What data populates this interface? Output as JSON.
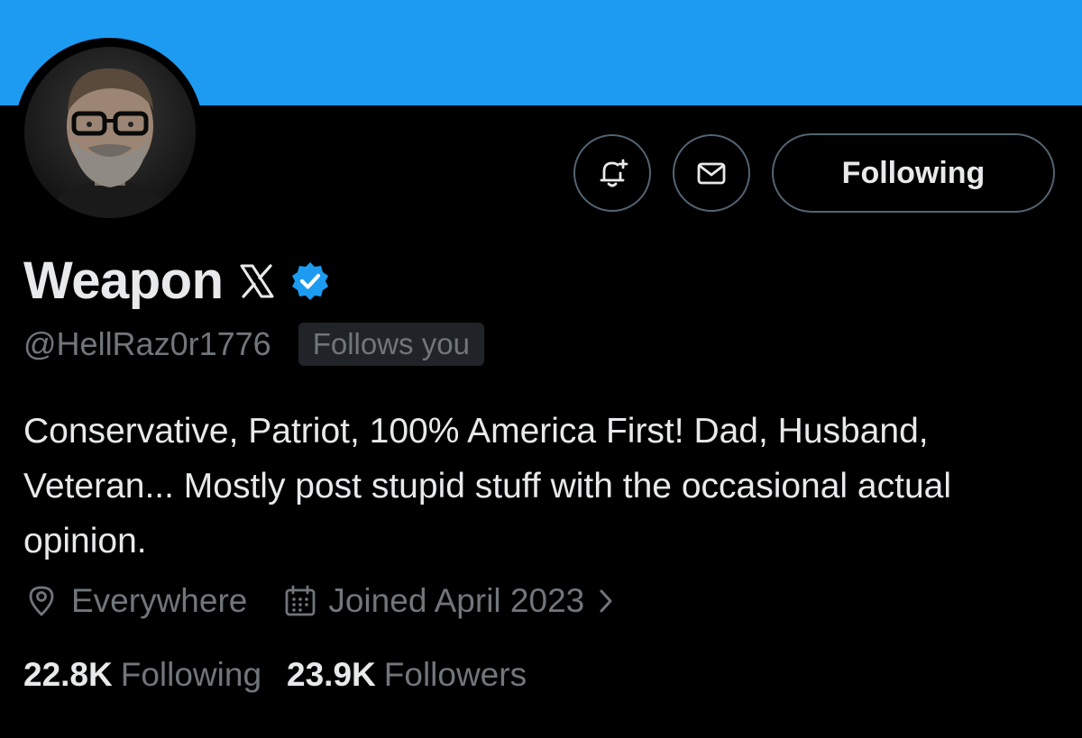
{
  "profile": {
    "display_name": "Weapon",
    "handle": "@HellRaz0r1776",
    "follows_you_badge": "Follows you",
    "bio": "Conservative, Patriot, 100% America First! Dad, Husband, Veteran... Mostly post stupid stuff with the occasional actual opinion.",
    "location": "Everywhere",
    "joined": "Joined April 2023",
    "following_count": "22.8K",
    "following_label": "Following",
    "followers_count": "23.9K",
    "followers_label": "Followers"
  },
  "actions": {
    "follow_state_label": "Following"
  },
  "colors": {
    "banner": "#1d9bf0",
    "background": "#000000",
    "text_primary": "#e7e9ea",
    "text_secondary": "#71767b",
    "verified_badge": "#1d9bf0",
    "button_border": "#536471"
  },
  "icons": {
    "notify": "bell-plus-icon",
    "message": "envelope-icon",
    "verified": "verified-badge-icon",
    "name_emoji": "x-logo-icon",
    "location": "location-pin-icon",
    "joined": "calendar-icon",
    "chevron": "chevron-right-icon"
  }
}
